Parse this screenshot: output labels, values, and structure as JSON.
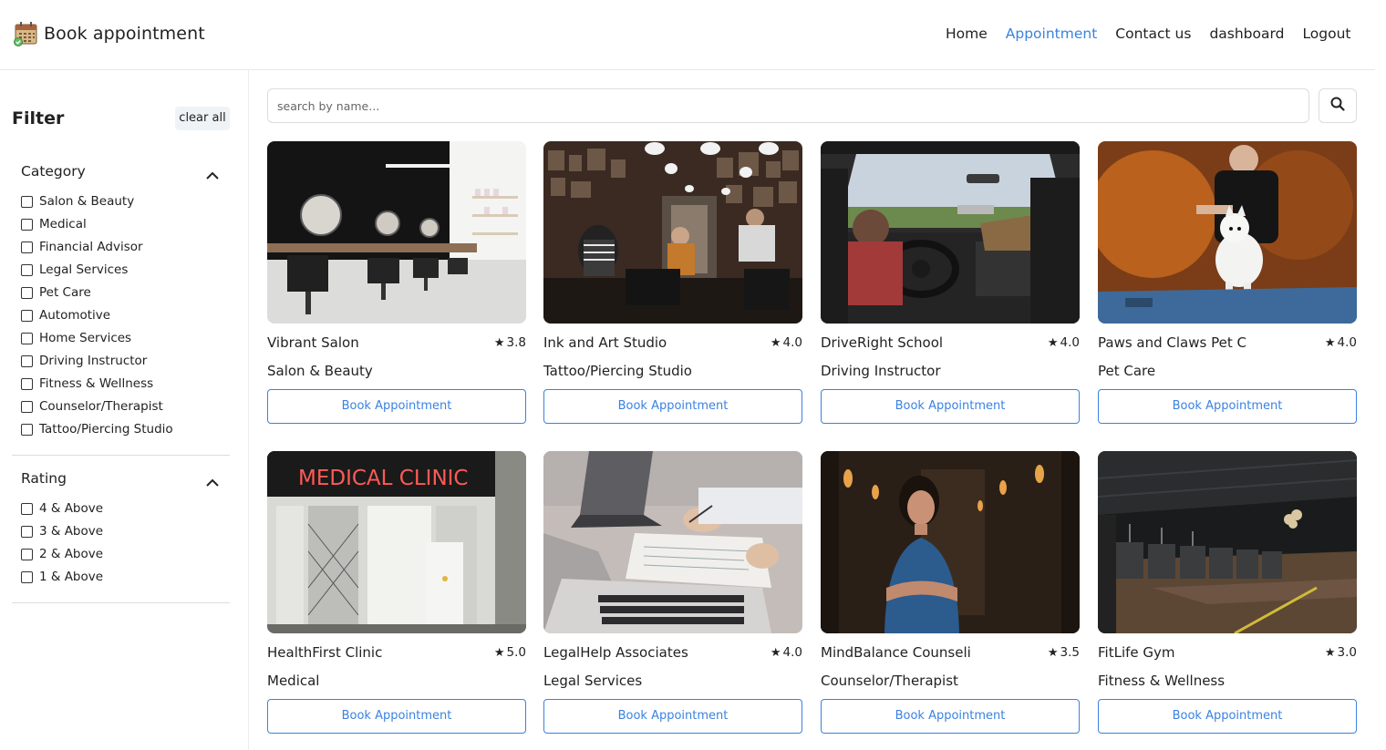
{
  "brand": {
    "title": "Book appointment"
  },
  "nav": {
    "items": [
      {
        "label": "Home",
        "active": false
      },
      {
        "label": "Appointment",
        "active": true
      },
      {
        "label": "Contact us",
        "active": false
      },
      {
        "label": "dashboard",
        "active": false
      },
      {
        "label": "Logout",
        "active": false
      }
    ]
  },
  "sidebar": {
    "title": "Filter",
    "clear_label": "clear all",
    "category": {
      "label": "Category",
      "options": [
        "Salon & Beauty",
        "Medical",
        "Financial Advisor",
        "Legal Services",
        "Pet Care",
        "Automotive",
        "Home Services",
        "Driving Instructor",
        "Fitness & Wellness",
        "Counselor/Therapist",
        "Tattoo/Piercing Studio"
      ]
    },
    "rating": {
      "label": "Rating",
      "options": [
        "4 & Above",
        "3 & Above",
        "2 & Above",
        "1 & Above"
      ]
    }
  },
  "search": {
    "placeholder": "search by name...",
    "value": ""
  },
  "cards": [
    {
      "name": "Vibrant Salon",
      "rating": "3.8",
      "category": "Salon & Beauty",
      "button": "Book Appointment",
      "image": "salon-photo"
    },
    {
      "name": "Ink and Art Studio",
      "rating": "4.0",
      "category": "Tattoo/Piercing Studio",
      "button": "Book Appointment",
      "image": "tattoo-studio-photo"
    },
    {
      "name": "DriveRight School",
      "rating": "4.0",
      "category": "Driving Instructor",
      "button": "Book Appointment",
      "image": "car-interior-photo"
    },
    {
      "name": "Paws and Claws Pet C",
      "rating": "4.0",
      "category": "Pet Care",
      "button": "Book Appointment",
      "image": "dog-grooming-photo"
    },
    {
      "name": "HealthFirst Clinic",
      "rating": "5.0",
      "category": "Medical",
      "button": "Book Appointment",
      "image": "clinic-storefront-photo",
      "sign": "MEDICAL CLINIC"
    },
    {
      "name": "LegalHelp Associates",
      "rating": "4.0",
      "category": "Legal Services",
      "button": "Book Appointment",
      "image": "laptop-desk-photo"
    },
    {
      "name": "MindBalance Counseli",
      "rating": "3.5",
      "category": "Counselor/Therapist",
      "button": "Book Appointment",
      "image": "therapist-portrait-photo"
    },
    {
      "name": "FitLife Gym",
      "rating": "3.0",
      "category": "Fitness & Wellness",
      "button": "Book Appointment",
      "image": "gym-interior-photo"
    }
  ],
  "colors": {
    "accent": "#3b82e0",
    "border": "#dcdcdc",
    "clear_bg": "#eef3f8"
  }
}
